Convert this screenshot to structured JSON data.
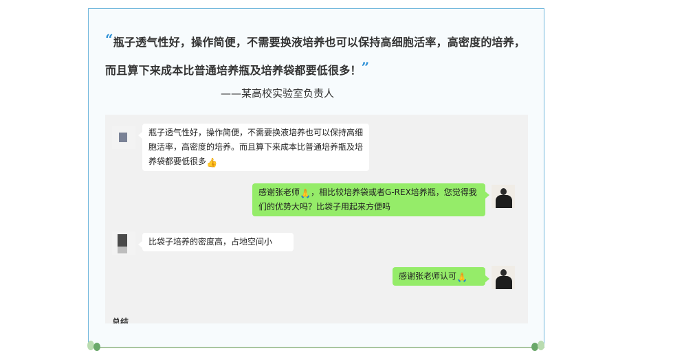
{
  "quote": {
    "open_mark": "“",
    "text": "瓶子透气性好，操作简便，不需要换液培养也可以保持高细胞活率，高密度的培养，而且算下来成本比普通培养瓶及培养袋都要低很多！",
    "close_mark": "”",
    "attribution": "——某高校实验室负责人"
  },
  "chat": {
    "messages": [
      {
        "side": "left",
        "text": "瓶子透气性好，操作简便，不需要换液培养也可以保持高细胞活率，高密度的培养。而且算下来成本比普通培养瓶及培养袋都要低很多",
        "emoji": "thumbs-up-icon"
      },
      {
        "side": "right",
        "text_before": "感谢张老师",
        "emoji": "praying-hands-icon",
        "text_after": "，相比较培养袋或者G-REX培养瓶，您觉得我们的优势大吗？比袋子用起来方便吗"
      },
      {
        "side": "left",
        "text": "比袋子培养的密度高，占地空间小"
      },
      {
        "side": "right",
        "text": "感谢张老师认可",
        "emoji": "praying-hands-icon"
      }
    ],
    "partial_text": "总结"
  },
  "colors": {
    "frame_border": "#6fb6dc",
    "quote_mark": "#2b8fd6",
    "bubble_green": "#95ec69",
    "bubble_white": "#ffffff",
    "chat_bg": "#f1f1f1"
  }
}
